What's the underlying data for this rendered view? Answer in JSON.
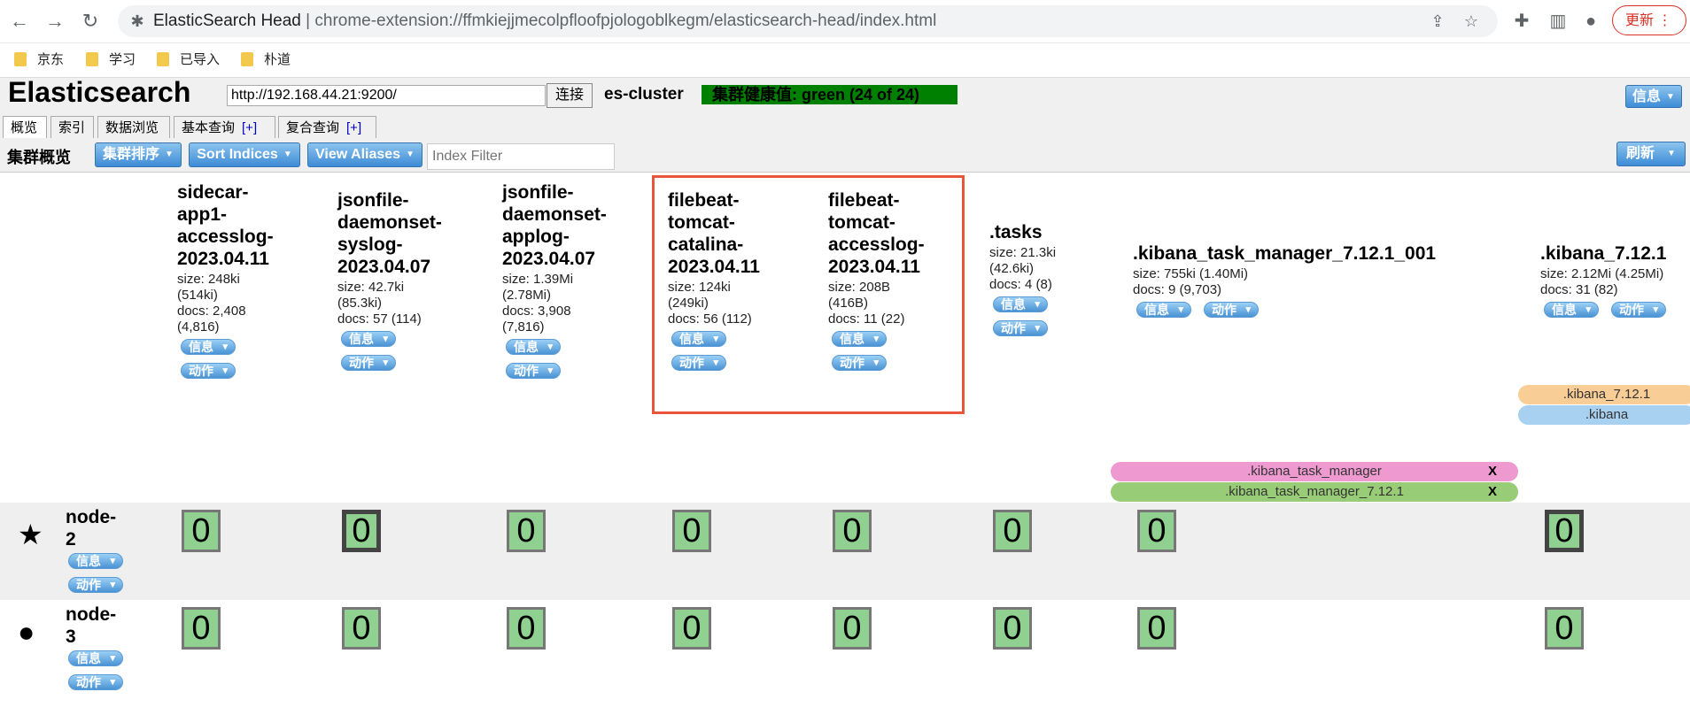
{
  "browser": {
    "title": "ElasticSearch Head",
    "separator": "|",
    "url": "chrome-extension://ffmkiejjmecolpfloofpjologoblkegm/elasticsearch-head/index.html",
    "update_label": "更新",
    "bookmarks": [
      "京东",
      "学习",
      "已导入",
      "朴道"
    ]
  },
  "header": {
    "brand": "Elasticsearch",
    "url_value": "http://192.168.44.21:9200/",
    "connect_label": "连接",
    "cluster_name": "es-cluster",
    "health": "集群健康值: green (24 of 24)",
    "info_label": "信息"
  },
  "tabs": [
    {
      "label": "概览"
    },
    {
      "label": "索引"
    },
    {
      "label": "数据浏览"
    },
    {
      "label": "基本查询",
      "plus": "[+]"
    },
    {
      "label": "复合查询",
      "plus": "[+]"
    }
  ],
  "toolbar": {
    "title": "集群概览",
    "cluster_sort": "集群排序",
    "sort_indices": "Sort Indices",
    "view_aliases": "View Aliases",
    "index_filter_placeholder": "Index Filter",
    "refresh": "刷新"
  },
  "labels": {
    "info": "信息",
    "action": "动作"
  },
  "indices": [
    {
      "name_lines": [
        "sidecar-",
        "app1-",
        "accesslog-",
        "2023.04.11"
      ],
      "meta_lines": [
        "size: 248ki",
        "(514ki)",
        "docs: 2,408",
        "(4,816)"
      ]
    },
    {
      "name_lines": [
        "jsonfile-",
        "daemonset-",
        "syslog-",
        "2023.04.07"
      ],
      "meta_lines": [
        "size: 42.7ki",
        "(85.3ki)",
        "docs: 57 (114)"
      ]
    },
    {
      "name_lines": [
        "jsonfile-",
        "daemonset-",
        "applog-",
        "2023.04.07"
      ],
      "meta_lines": [
        "size: 1.39Mi",
        "(2.78Mi)",
        "docs: 3,908",
        "(7,816)"
      ]
    },
    {
      "name_lines": [
        "filebeat-",
        "tomcat-",
        "catalina-",
        "2023.04.11"
      ],
      "meta_lines": [
        "size: 124ki",
        "(249ki)",
        "docs: 56 (112)"
      ]
    },
    {
      "name_lines": [
        "filebeat-",
        "tomcat-",
        "accesslog-",
        "2023.04.11"
      ],
      "meta_lines": [
        "size: 208B",
        "(416B)",
        "docs: 11 (22)"
      ]
    },
    {
      "name_lines": [
        ".tasks"
      ],
      "meta_lines": [
        "size: 21.3ki",
        "(42.6ki)",
        "docs: 4 (8)"
      ]
    },
    {
      "name_lines": [
        ".kibana_task_manager_7.12.1_001"
      ],
      "meta_lines": [
        "size: 755ki (1.40Mi)",
        "docs: 9 (9,703)"
      ]
    },
    {
      "name_lines": [
        ".kibana_7.12.1"
      ],
      "meta_lines": [
        "size: 2.12Mi (4.25Mi)",
        "docs: 31 (82)"
      ]
    }
  ],
  "aliases": [
    {
      "label": ".kibana_7.12.1",
      "color": "#f9cd96"
    },
    {
      "label": ".kibana",
      "color": "#a8d0f0"
    },
    {
      "label": ".kibana_task_manager",
      "close": "X",
      "color": "#ee9ad0"
    },
    {
      "label": ".kibana_task_manager_7.12.1",
      "close": "X",
      "color": "#99cc77"
    }
  ],
  "nodes": [
    {
      "name_lines": [
        "node-",
        "2"
      ],
      "marker": "star-icon",
      "shards": [
        "0",
        "0",
        "0",
        "0",
        "0",
        "0",
        "0",
        "0"
      ]
    },
    {
      "name_lines": [
        "node-",
        "3"
      ],
      "marker": "circle-icon",
      "shards": [
        "0",
        "0",
        "0",
        "0",
        "0",
        "0",
        "0",
        "0"
      ]
    }
  ],
  "colors": {
    "health": "#008000",
    "shard": "#90d090",
    "highlight": "#e8553a"
  }
}
